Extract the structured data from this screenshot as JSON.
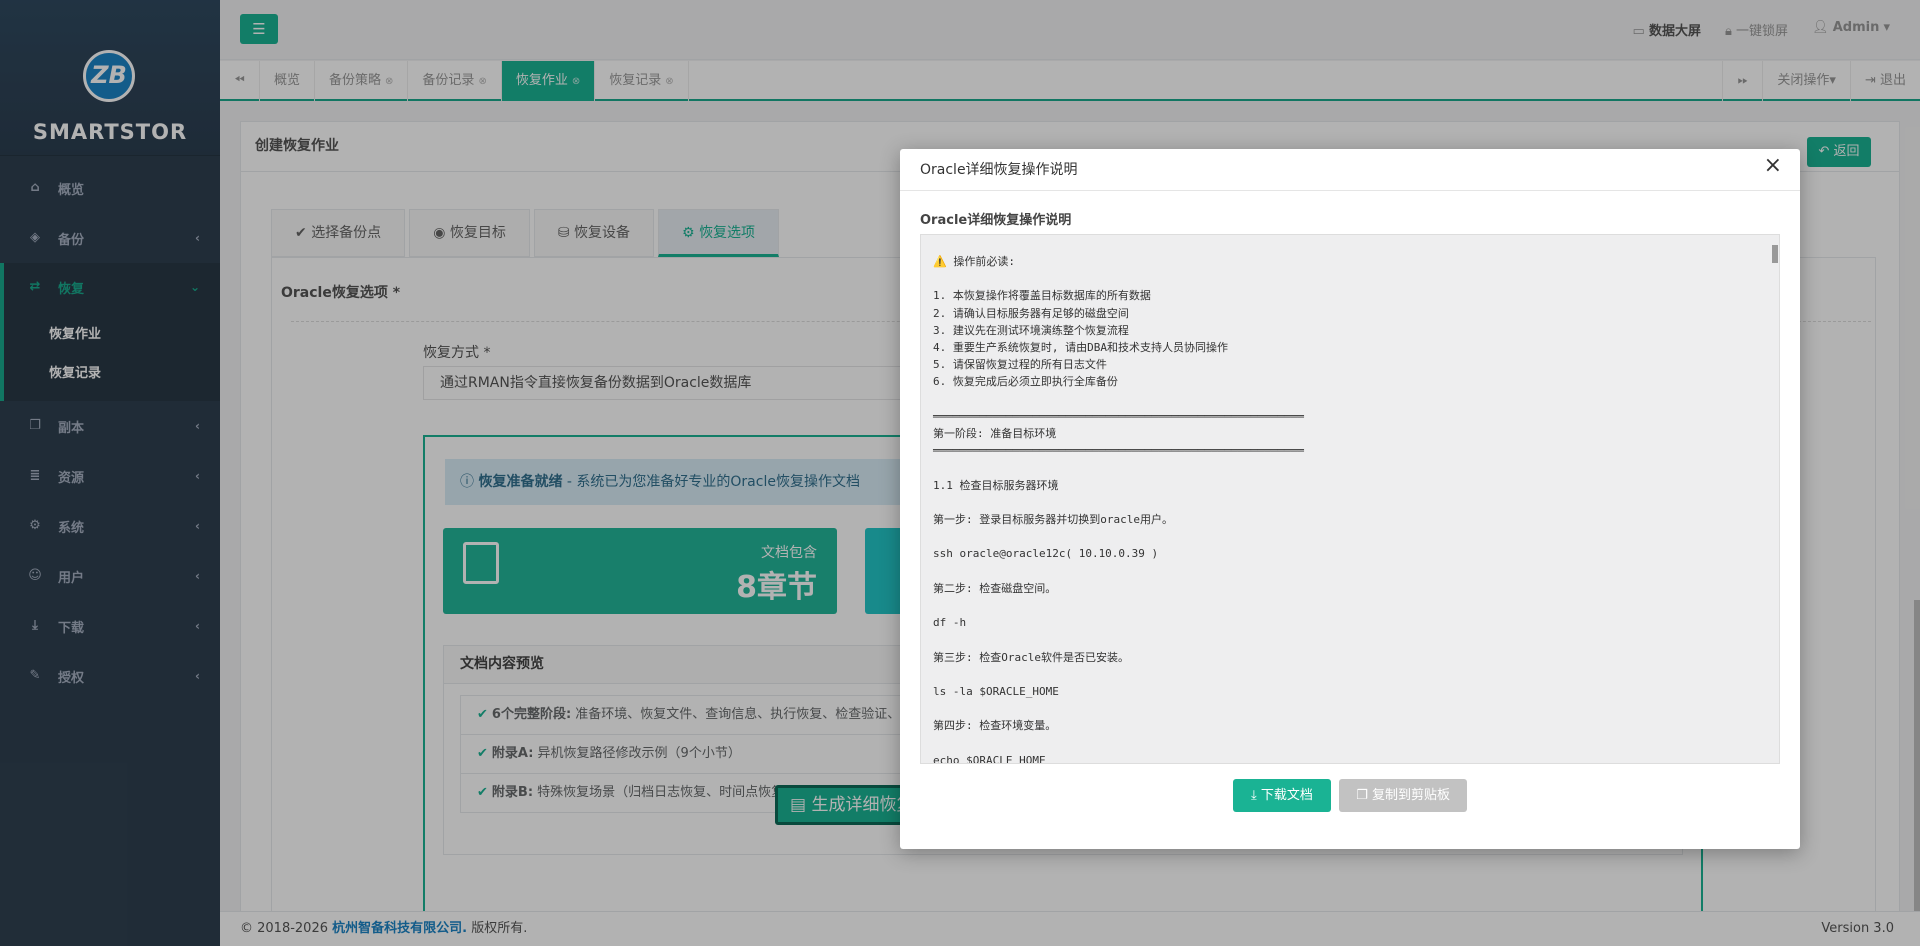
{
  "brand": {
    "name": "SMARTSTOR",
    "logo_text": "ZB"
  },
  "sidebar": {
    "items": [
      {
        "label": "概览",
        "icon": "home-icon"
      },
      {
        "label": "备份",
        "icon": "cube-icon"
      },
      {
        "label": "恢复",
        "icon": "refresh-icon"
      },
      {
        "label": "副本",
        "icon": "copy-icon"
      },
      {
        "label": "资源",
        "icon": "server-icon"
      },
      {
        "label": "系统",
        "icon": "cogs-icon"
      },
      {
        "label": "用户",
        "icon": "users-icon"
      },
      {
        "label": "下载",
        "icon": "download-icon"
      },
      {
        "label": "授权",
        "icon": "edit-icon"
      }
    ],
    "subitems": [
      "恢复作业",
      "恢复记录"
    ]
  },
  "topbar": {
    "screen": "数据大屏",
    "lock": "一键锁屏",
    "user": "Admin"
  },
  "tabs": {
    "items": [
      "概览",
      "备份策略",
      "备份记录",
      "恢复作业",
      "恢复记录"
    ],
    "close_ops": "关闭操作",
    "logout": "退出"
  },
  "page": {
    "title": "创建恢复作业",
    "back": "返回",
    "wizard": [
      "选择备份点",
      "恢复目标",
      "恢复设备",
      "恢复选项"
    ],
    "section_title": "Oracle恢复选项 *",
    "method_label": "恢复方式 *",
    "method_value": "通过RMAN指令直接恢复备份数据到Oracle数据库",
    "info_bold": "恢复准备就绪",
    "info_text": " - 系统已为您准备好专业的Oracle恢复操作文档",
    "card_sub": "文档包含",
    "card_val": "8章节",
    "preview_title": "文档内容预览",
    "preview_items": [
      {
        "bold": "6个完整阶段:",
        "text": " 准备环境、恢复文件、查询信息、执行恢复、检查验证、"
      },
      {
        "bold": "附录A:",
        "text": " 异机恢复路径修改示例（9个小节）"
      },
      {
        "bold": "附录B:",
        "text": " 特殊恢复场景（归档日志恢复、时间点恢复）"
      }
    ],
    "generate": "生成详细恢复操作说明"
  },
  "modal": {
    "title": "Oracle详细恢复操作说明",
    "subtitle": "Oracle详细恢复操作说明",
    "doc": "⚠️ 操作前必读:\n\n1. 本恢复操作将覆盖目标数据库的所有数据\n2. 请确认目标服务器有足够的磁盘空间\n3. 建议先在测试环境演练整个恢复流程\n4. 重要生产系统恢复时, 请由DBA和技术支持人员协同操作\n5. 请保留恢复过程的所有日志文件\n6. 恢复完成后必须立即执行全库备份\n\n════════════════════════════════════════════════════════\n第一阶段: 准备目标环境\n════════════════════════════════════════════════════════\n\n1.1 检查目标服务器环境\n\n第一步: 登录目标服务器并切换到oracle用户。\n\nssh oracle@oracle12c( 10.10.0.39 )\n\n第二步: 检查磁盘空间。\n\ndf -h\n\n第三步: 检查Oracle软件是否已安装。\n\nls -la $ORACLE_HOME\n\n第四步: 检查环境变量。\n\necho $ORACLE_HOME",
    "download": "下载文档",
    "copy": "复制到剪贴板"
  },
  "footer": {
    "copy": "© 2018-2026 ",
    "company": "杭州智备科技有限公司.",
    "rights": " 版权所有.",
    "version": "Version 3.0"
  }
}
